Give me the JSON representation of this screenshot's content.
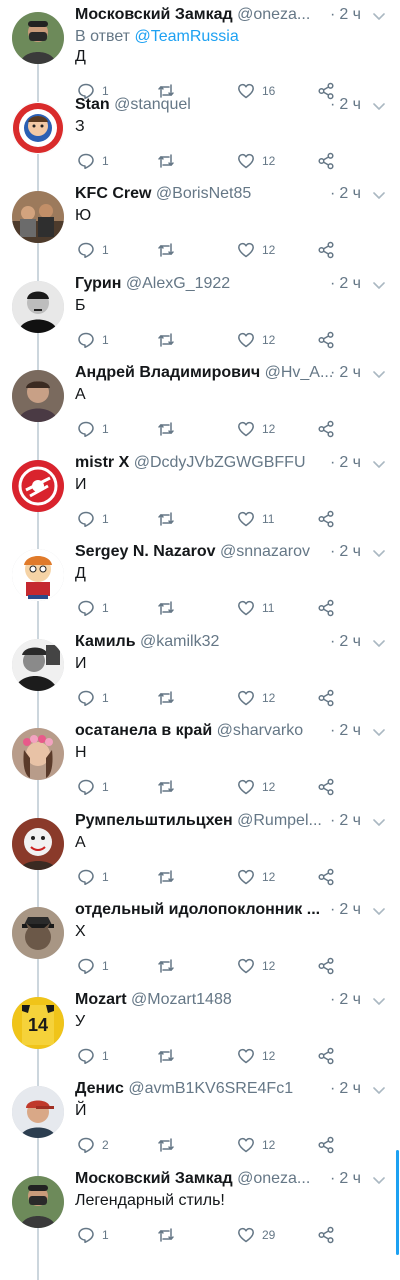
{
  "colors": {
    "accent": "#1da1f2",
    "secondary_text": "#657786",
    "primary_text": "#14171a",
    "thread_line": "#ccd6dd"
  },
  "tweets": [
    {
      "display_name": "Московский Замкад",
      "handle": "@oneza...",
      "time": "2 ч",
      "reply_prefix": "В ответ",
      "reply_mention": "@TeamRussia",
      "text": "Д",
      "replies": "1",
      "retweets": "",
      "likes": "16",
      "avatar": "masked-man-avatar"
    },
    {
      "display_name": "Stan",
      "handle": "@stanquel",
      "time": "2 ч",
      "text": "З",
      "replies": "1",
      "retweets": "",
      "likes": "12",
      "avatar": "cartoon-shield-avatar"
    },
    {
      "display_name": "KFC Crew",
      "handle": "@BorisNet85",
      "time": "2 ч",
      "text": "Ю",
      "replies": "1",
      "retweets": "",
      "likes": "12",
      "avatar": "group-photo-avatar"
    },
    {
      "display_name": "Гурин",
      "handle": "@AlexG_1922",
      "time": "2 ч",
      "text": "Б",
      "replies": "1",
      "retweets": "",
      "likes": "12",
      "avatar": "bw-portrait-avatar"
    },
    {
      "display_name": "Андрей Владимирович",
      "handle": "@Hv_A...",
      "time": "2 ч",
      "text": "А",
      "replies": "1",
      "retweets": "",
      "likes": "12",
      "avatar": "portrait-avatar"
    },
    {
      "display_name": "mistr X",
      "handle": "@DcdyJVbZGWGBFFU",
      "time": "2 ч",
      "text": "И",
      "replies": "1",
      "retweets": "",
      "likes": "11",
      "avatar": "club-logo-avatar"
    },
    {
      "display_name": "Sergey N. Nazarov",
      "handle": "@snnazarov",
      "time": "2 ч",
      "text": "Д",
      "replies": "1",
      "retweets": "",
      "likes": "11",
      "avatar": "cartoon-boy-avatar"
    },
    {
      "display_name": "Камиль",
      "handle": "@kamilk32",
      "time": "2 ч",
      "text": "И",
      "replies": "1",
      "retweets": "",
      "likes": "12",
      "avatar": "bw-soldier-avatar"
    },
    {
      "display_name": "осатанела в край",
      "handle": "@sharvarko",
      "time": "2 ч",
      "text": "Н",
      "replies": "1",
      "retweets": "",
      "likes": "12",
      "avatar": "flower-crown-avatar"
    },
    {
      "display_name": "Румпельштильцхен",
      "handle": "@Rumpel...",
      "time": "2 ч",
      "text": "А",
      "replies": "1",
      "retweets": "",
      "likes": "12",
      "avatar": "masked-face-avatar"
    },
    {
      "display_name": "отдельный идолопоклонник ...",
      "handle": "",
      "time": "2 ч",
      "text": "Х",
      "replies": "1",
      "retweets": "",
      "likes": "12",
      "avatar": "officer-cat-avatar"
    },
    {
      "display_name": "Mozart",
      "handle": "@Mozart1488",
      "time": "2 ч",
      "text": "У",
      "replies": "1",
      "retweets": "",
      "likes": "12",
      "avatar": "jersey-14-avatar",
      "avatar_jersey_number": "14"
    },
    {
      "display_name": "Денис",
      "handle": "@avmB1KV6SRE4Fc1",
      "time": "2 ч",
      "text": "Й",
      "replies": "2",
      "retweets": "",
      "likes": "12",
      "avatar": "man-in-cap-avatar"
    },
    {
      "display_name": "Московский Замкад",
      "handle": "@oneza...",
      "time": "2 ч",
      "text": "Легендарный стиль!",
      "replies": "1",
      "retweets": "",
      "likes": "29",
      "avatar": "masked-man-avatar"
    }
  ]
}
